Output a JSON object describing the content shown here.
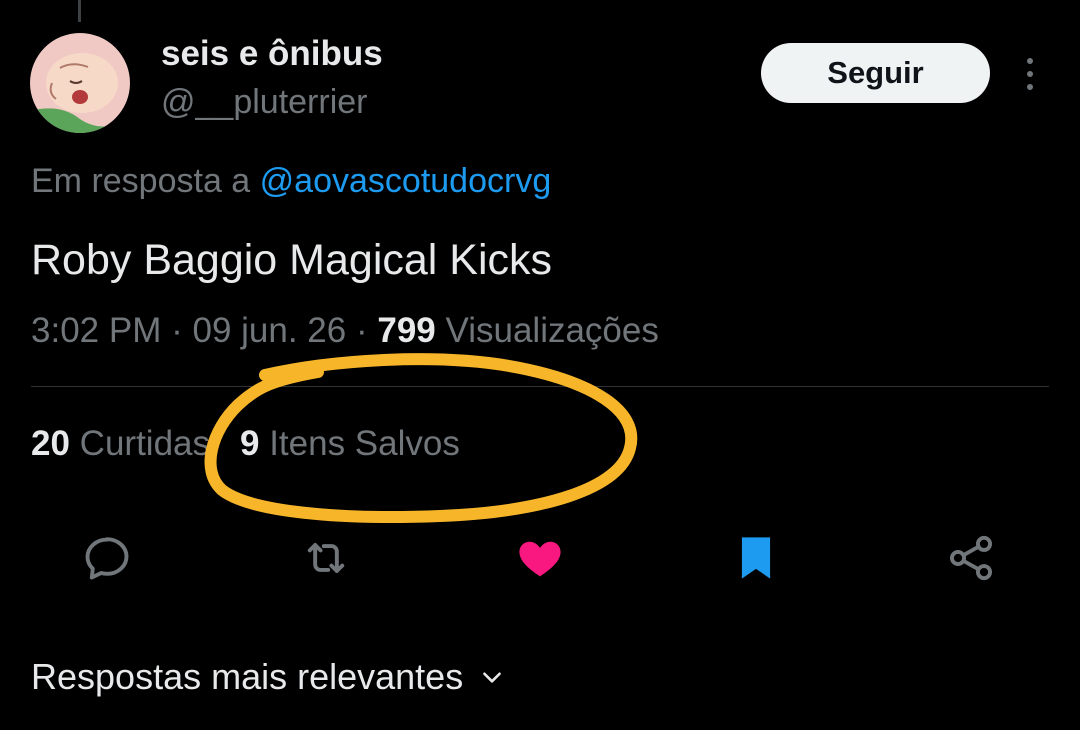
{
  "author": {
    "display_name": "seis e ônibus",
    "handle": "@__pluterrier"
  },
  "follow_button": {
    "label": "Seguir"
  },
  "reply_context": {
    "prefix": "Em resposta a",
    "mention": "@aovascotudocrvg"
  },
  "tweet": {
    "text": "Roby Baggio Magical Kicks",
    "time": "3:02 PM",
    "date": "09 jun. 26",
    "views_count": "799",
    "views_label": "Visualizações"
  },
  "stats": {
    "likes_count": "20",
    "likes_label": "Curtidas",
    "saves_count": "9",
    "saves_label": "Itens Salvos"
  },
  "actions": [
    {
      "name": "reply",
      "icon": "reply-icon"
    },
    {
      "name": "retweet",
      "icon": "retweet-icon"
    },
    {
      "name": "like",
      "icon": "heart-icon",
      "active": true
    },
    {
      "name": "bookmark",
      "icon": "bookmark-icon",
      "active": true
    },
    {
      "name": "share",
      "icon": "share-icon"
    }
  ],
  "replies_sort": {
    "label": "Respostas mais relevantes"
  },
  "colors": {
    "background": "#000000",
    "text_primary": "#e7e9ea",
    "text_secondary": "#71767b",
    "link": "#1d9bf0",
    "like_active": "#f91880",
    "bookmark_active": "#1d9bf0",
    "annotation": "#f7b52a"
  }
}
